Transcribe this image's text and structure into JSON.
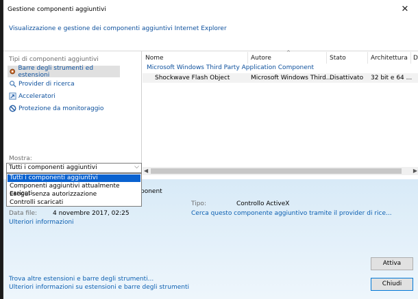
{
  "window": {
    "title": "Gestione componenti aggiuntivi",
    "close_glyph": "✕"
  },
  "header": {
    "description": "Visualizzazione e gestione dei componenti aggiuntivi Internet Explorer"
  },
  "sidebar": {
    "section_label": "Tipi di componenti aggiuntivi",
    "items": [
      {
        "label": "Barre degli strumenti ed estensioni",
        "icon": "gear-icon",
        "selected": true
      },
      {
        "label": "Provider di ricerca",
        "icon": "search-icon",
        "selected": false
      },
      {
        "label": "Acceleratori",
        "icon": "accelerator-icon",
        "selected": false
      },
      {
        "label": "Protezione da monitoraggio",
        "icon": "blocked-icon",
        "selected": false
      }
    ],
    "show_label": "Mostra:",
    "show_value": "Tutti i componenti aggiuntivi",
    "show_options": [
      "Tutti i componenti aggiuntivi",
      "Componenti aggiuntivi attualmente caricati",
      "Esegui senza autorizzazione",
      "Controlli scaricati"
    ]
  },
  "grid": {
    "columns": [
      "Nome",
      "Autore",
      "Stato",
      "Architettura",
      "D"
    ],
    "group": "Microsoft Windows Third Party Application Component",
    "rows": [
      {
        "name": "Shockwave Flash Object",
        "author": "Microsoft Windows Third...",
        "status": "Disattivato",
        "arch": "32 bit e 64 ..."
      }
    ]
  },
  "detail": {
    "title_fragment": "ponent",
    "type_label": "Tipo:",
    "type_value": "Controllo ActiveX",
    "search_link": "Cerca questo componente aggiuntivo tramite il provider di ricerca...",
    "search_link_display": "Cerca questo componente aggiuntivo tramite il provider di rice...",
    "date_label": "Data file:",
    "date_value": "4 novembre 2017, 02:25",
    "more_info": "Ulteriori informazioni",
    "activate_button": "Attiva"
  },
  "footer": {
    "find_more": "Trova altre estensioni e barre degli strumenti...",
    "learn_more": "Ulteriori informazioni su estensioni e barre degli strumenti",
    "close_button": "Chiudi"
  },
  "colors": {
    "link": "#0b5fb1",
    "selection": "#0a62d0",
    "detail_bg": "#d8eaf7"
  }
}
